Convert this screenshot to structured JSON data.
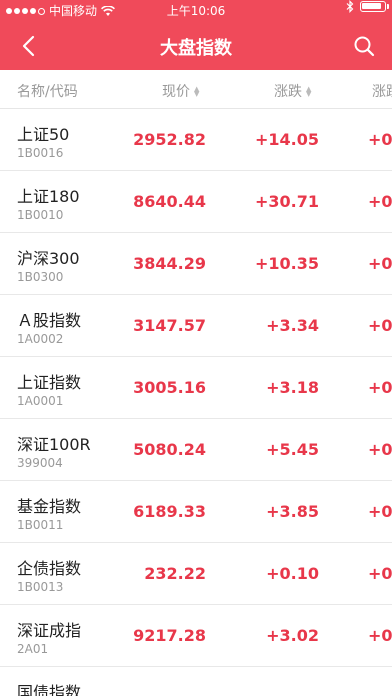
{
  "status_bar": {
    "carrier": "中国移动",
    "time": "上午10:06",
    "battery_level": 0.9
  },
  "nav": {
    "title": "大盘指数"
  },
  "columns": {
    "name": "名称/代码",
    "price": "现价",
    "change": "涨跌",
    "pct": "涨跌"
  },
  "rows": [
    {
      "name": "上证50",
      "code": "1B0016",
      "price": "2952.82",
      "change": "+14.05",
      "pct": "+0."
    },
    {
      "name": "上证180",
      "code": "1B0010",
      "price": "8640.44",
      "change": "+30.71",
      "pct": "+0."
    },
    {
      "name": "沪深300",
      "code": "1B0300",
      "price": "3844.29",
      "change": "+10.35",
      "pct": "+0."
    },
    {
      "name": "Ａ股指数",
      "code": "1A0002",
      "price": "3147.57",
      "change": "+3.34",
      "pct": "+0."
    },
    {
      "name": "上证指数",
      "code": "1A0001",
      "price": "3005.16",
      "change": "+3.18",
      "pct": "+0."
    },
    {
      "name": "深证100R",
      "code": "399004",
      "price": "5080.24",
      "change": "+5.45",
      "pct": "+0."
    },
    {
      "name": "基金指数",
      "code": "1B0011",
      "price": "6189.33",
      "change": "+3.85",
      "pct": "+0."
    },
    {
      "name": "企债指数",
      "code": "1B0013",
      "price": "232.22",
      "change": "+0.10",
      "pct": "+0."
    },
    {
      "name": "深证成指",
      "code": "2A01",
      "price": "9217.28",
      "change": "+3.02",
      "pct": "+0."
    },
    {
      "name": "国债指数",
      "code": "",
      "price": "",
      "change": "",
      "pct": ""
    }
  ],
  "colors": {
    "header_red": "#f04a5a",
    "rise_red": "#e8374a"
  },
  "icons": {
    "back": "chevron-left-icon",
    "search": "search-icon",
    "wifi": "wifi-icon",
    "bluetooth": "bluetooth-icon",
    "battery": "battery-icon",
    "sort": "sort-arrows-icon"
  }
}
